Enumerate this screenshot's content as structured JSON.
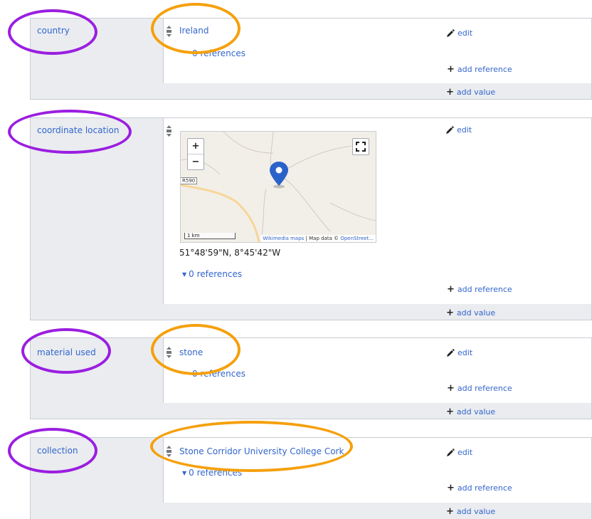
{
  "statements": [
    {
      "property": "country",
      "value": "Ireland",
      "edit_label": "edit",
      "references": "0 references",
      "add_reference": "add reference",
      "add_value": "add value"
    },
    {
      "property": "coordinate location",
      "value": "51°48'59\"N, 8°45'42\"W",
      "edit_label": "edit",
      "references": "0 references",
      "add_reference": "add reference",
      "add_value": "add value",
      "map": {
        "zoom_in": "+",
        "zoom_out": "−",
        "road_label": "R590",
        "scale": "1 km",
        "attribution_link": "Wikimedia maps",
        "attribution_text": " | Map data © ",
        "attribution_osm": "OpenStreet..."
      }
    },
    {
      "property": "material used",
      "value": "stone",
      "edit_label": "edit",
      "references": "0 references",
      "add_reference": "add reference",
      "add_value": "add value"
    },
    {
      "property": "collection",
      "value": "Stone Corridor University College Cork",
      "edit_label": "edit",
      "references": "0 references",
      "add_reference": "add reference",
      "add_value": "add value"
    }
  ],
  "colors": {
    "link": "#3366cc",
    "panel_bg": "#eaecf0",
    "annotation_purple": "#9b1ee0",
    "annotation_orange": "#f5a00c"
  },
  "icons": [
    "rank-normal-icon",
    "pencil-icon",
    "plus-icon",
    "triangle-down-icon",
    "map-marker-icon",
    "fullscreen-icon"
  ]
}
